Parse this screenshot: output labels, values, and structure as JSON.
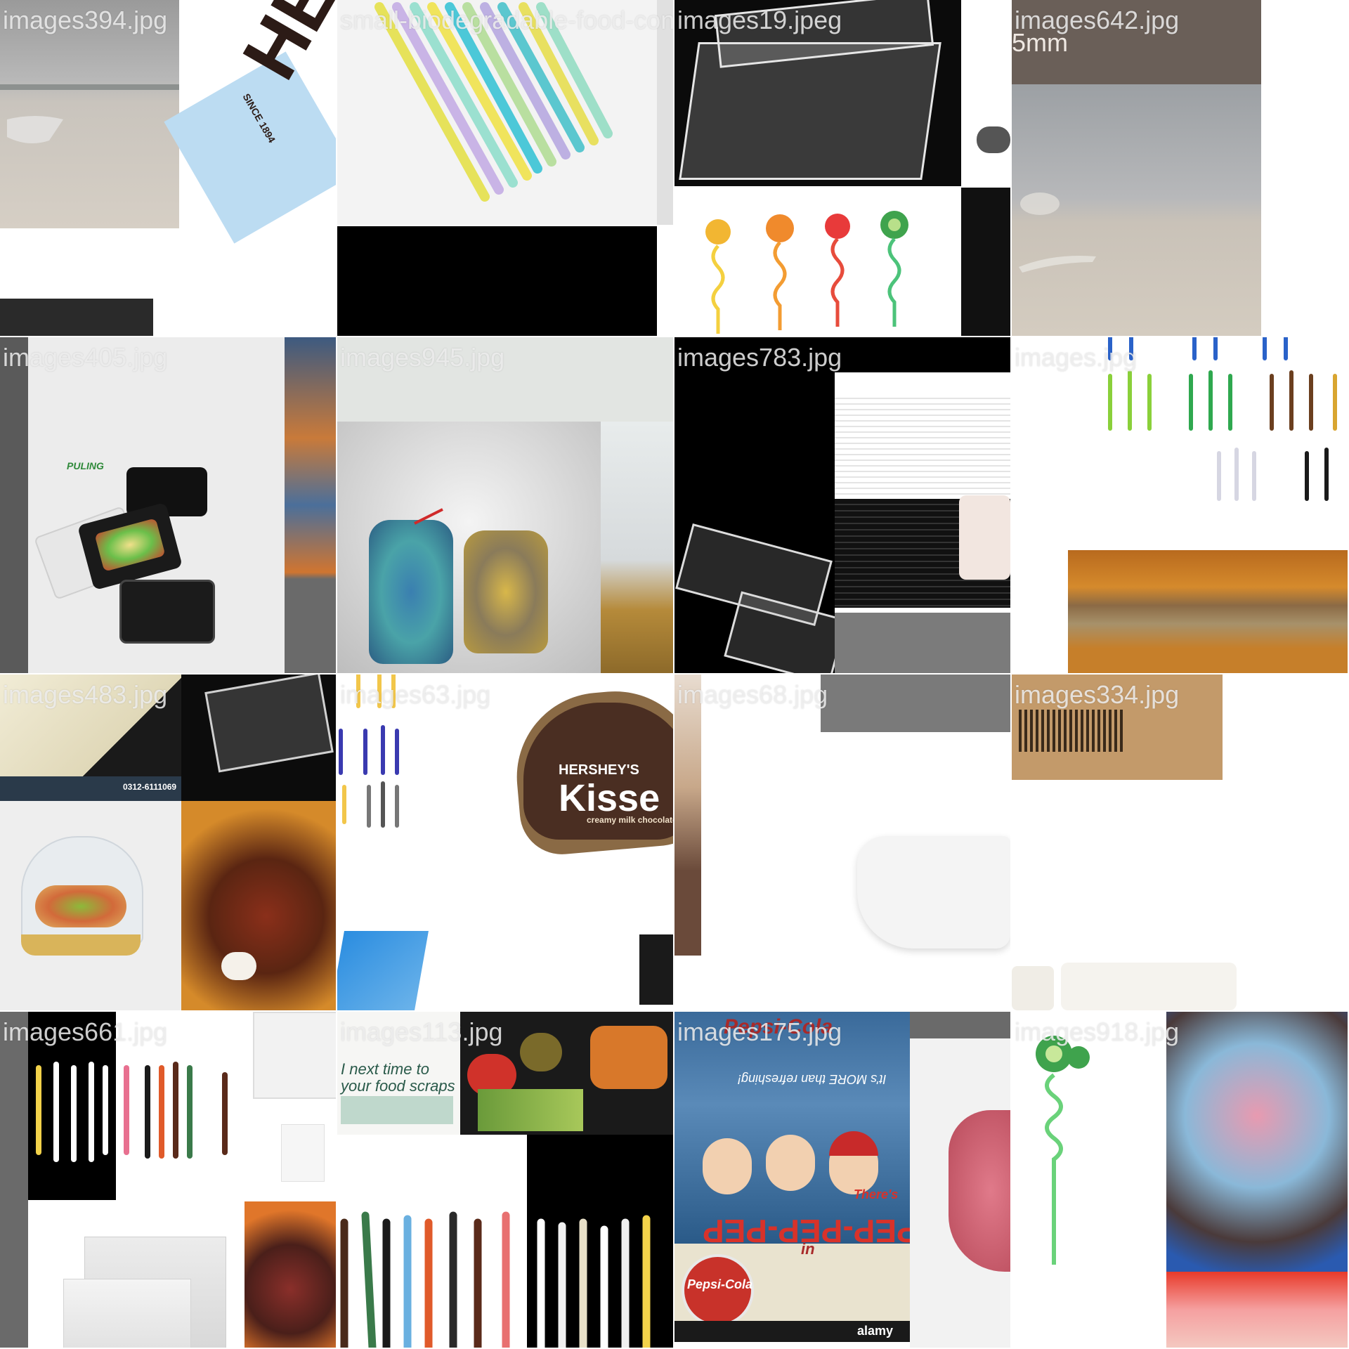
{
  "grid": {
    "tiles": [
      {
        "caption": "images394.jpg",
        "subject": "beach with plastic fork, chocolate wrapper"
      },
      {
        "caption": "small-biodegradable-food-container.jpg",
        "subject": "colorful drinking straws"
      },
      {
        "caption": "images19.jpeg",
        "subject": "clear compartment trays, novelty straws"
      },
      {
        "caption": "images642.jpg",
        "subject": "beach with plastic cutlery"
      },
      {
        "caption": "images405.jpg",
        "subject": "black meal-prep containers"
      },
      {
        "caption": "images945.jpg",
        "subject": "clear bags of bottle caps and candy"
      },
      {
        "caption": "images783.jpg",
        "subject": "stacked black containers"
      },
      {
        "caption": "images.jpg",
        "subject": "colored plastic cutlery"
      },
      {
        "caption": "images483.jpg",
        "subject": "clear dome food container, steak"
      },
      {
        "caption": "images63.jpg",
        "subject": "cutlery and chocolate kisses"
      },
      {
        "caption": "images68.jpg",
        "subject": "white foam food container"
      },
      {
        "caption": "images334.jpg",
        "subject": "cardboard box and trays"
      },
      {
        "caption": "images661.jpg",
        "subject": "kitchen utensils, zip bags, steak"
      },
      {
        "caption": "images113.jpg",
        "subject": "vegetables and kitchen utensils"
      },
      {
        "caption": "images175.jpg",
        "subject": "vintage Pepsi-Cola advertisement"
      },
      {
        "caption": "images918.jpg",
        "subject": "kiwi straw and party cups"
      }
    ]
  },
  "texts": {
    "hershey_wrapper": "HERSH",
    "hershey_since": "SINCE 1894",
    "screw_size": "5mm",
    "puling_logo": "PULING",
    "social_bar": "0312-6111069",
    "kisses_brand": "HERSHEY'S",
    "kisses_word": "Kisse",
    "kisses_sub": "creamy milk chocolate",
    "compost_note": "I next time to your food scraps",
    "pepsi_slogan": "PEP-PEP-PEP",
    "pepsi_brand": "Pepsi-Cola",
    "pepsi_refresh": "It's MORE than refreshing!",
    "pepsi_theres": "There's",
    "pepsi_in": "in",
    "alamy": "alamy",
    "pepsi_top": "Pepsi-Cola"
  }
}
